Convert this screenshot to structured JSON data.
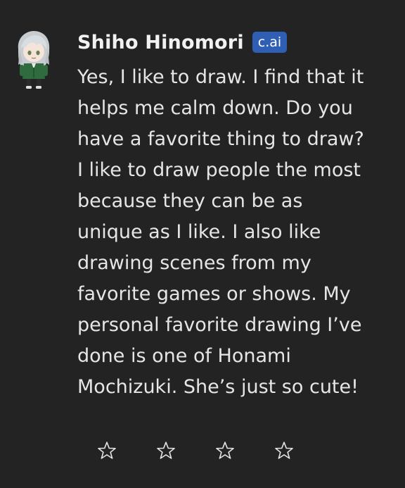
{
  "message": {
    "author": "Shiho Hinomori",
    "badge": "c.ai",
    "text": "Yes, I like to draw. I find that it\nhelps me calm down. Do you\nhave a favorite thing to draw?\nI like to draw people the most\nbecause they can be as\nunique as I like. I also like\ndrawing scenes from my\nfavorite games or shows. My\npersonal favorite drawing I’ve\ndone is one of Honami\nMochizuki. She’s just so cute!"
  },
  "rating": {
    "max_stars": 5,
    "visible_stars": 4,
    "selected": 0,
    "star_icon": "star-outline-icon"
  },
  "colors": {
    "background": "#232323",
    "text": "#e6e6e6",
    "badge_bg": "#2f5fb5",
    "avatar_hair": "#c9cfd3",
    "avatar_clothes": "#2f6b3f"
  }
}
